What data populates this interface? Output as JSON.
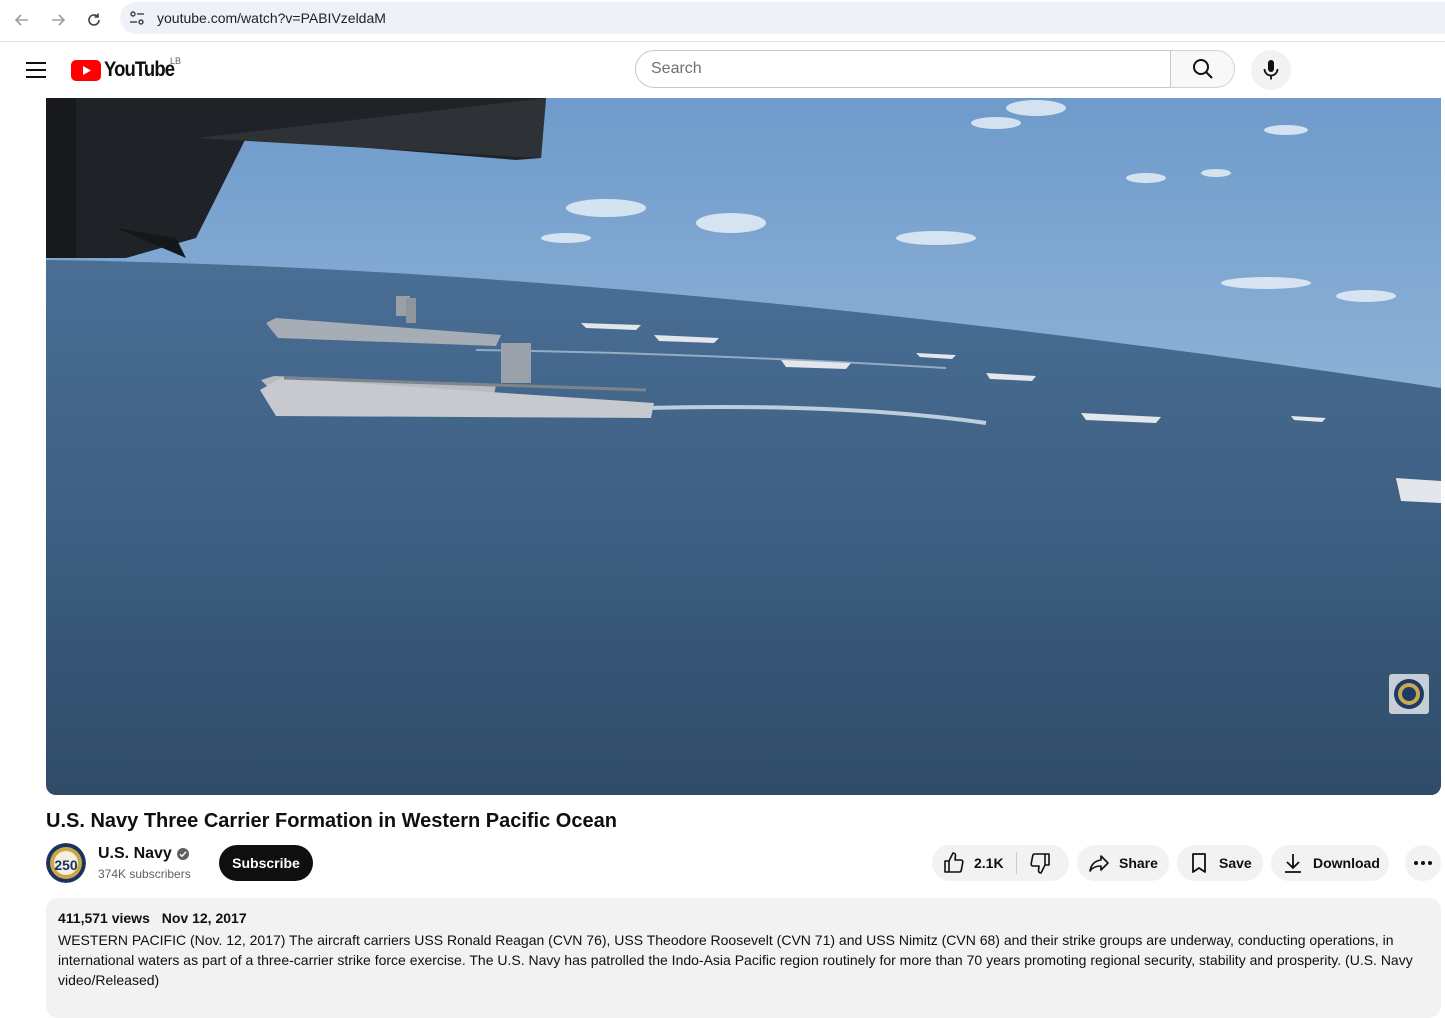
{
  "browser": {
    "url": "youtube.com/watch?v=PABIVzeldaM"
  },
  "header": {
    "logo_text": "YouTube",
    "country_code": "LB",
    "search_placeholder": "Search"
  },
  "video": {
    "title": "U.S. Navy Three Carrier Formation in Western Pacific Ocean"
  },
  "channel": {
    "name": "U.S. Navy",
    "subscribers": "374K subscribers",
    "avatar_text": "250",
    "subscribe_label": "Subscribe"
  },
  "actions": {
    "likes": "2.1K",
    "share_label": "Share",
    "save_label": "Save",
    "download_label": "Download"
  },
  "description": {
    "views": "411,571 views",
    "date": "Nov 12, 2017",
    "text": "WESTERN PACIFIC (Nov. 12, 2017) The aircraft carriers USS Ronald Reagan (CVN 76), USS Theodore Roosevelt (CVN 71) and USS Nimitz (CVN 68) and their strike groups are underway, conducting operations, in international waters as part of a three-carrier strike force exercise. The U.S. Navy has patrolled the Indo-Asia Pacific region routinely for more than 70 years promoting regional security, stability and prosperity. (U.S. Navy video/Released)"
  },
  "colors": {
    "brand_red": "#ff0000",
    "sea": "#3e5a76",
    "sky": "#a9c6e2"
  },
  "icons": [
    "back-icon",
    "forward-icon",
    "reload-icon",
    "site-settings-icon",
    "menu-icon",
    "youtube-logo-icon",
    "search-icon",
    "mic-icon",
    "verified-icon",
    "like-icon",
    "dislike-icon",
    "share-icon",
    "save-icon",
    "download-icon",
    "more-icon",
    "navy-watermark-icon"
  ]
}
